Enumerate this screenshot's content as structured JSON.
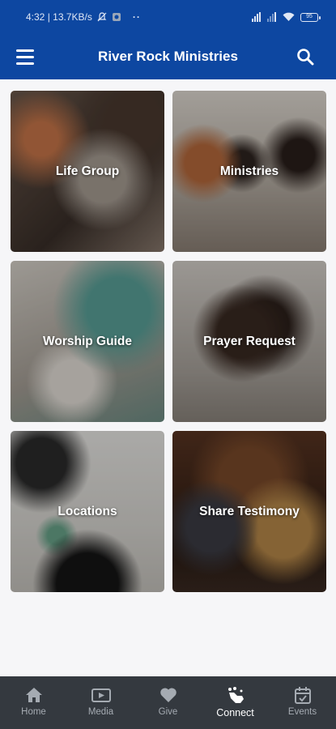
{
  "status": {
    "time_info": "4:32 | 13.7KB/s",
    "battery": "95",
    "overflow": "··"
  },
  "app_bar": {
    "title": "River Rock Ministries"
  },
  "tiles": [
    {
      "label": "Life Group"
    },
    {
      "label": "Ministries"
    },
    {
      "label": "Worship Guide"
    },
    {
      "label": "Prayer Request"
    },
    {
      "label": "Locations"
    },
    {
      "label": "Share Testimony"
    }
  ],
  "bottom_nav": {
    "items": [
      {
        "label": "Home",
        "icon": "home-icon"
      },
      {
        "label": "Media",
        "icon": "video-icon"
      },
      {
        "label": "Give",
        "icon": "heart-icon"
      },
      {
        "label": "Connect",
        "icon": "connect-icon",
        "active": true
      },
      {
        "label": "Events",
        "icon": "calendar-icon"
      }
    ]
  },
  "colors": {
    "primary": "#0d47a1",
    "nav_background": "#34393f",
    "nav_inactive": "#a5abb2",
    "nav_active": "#ffffff"
  }
}
